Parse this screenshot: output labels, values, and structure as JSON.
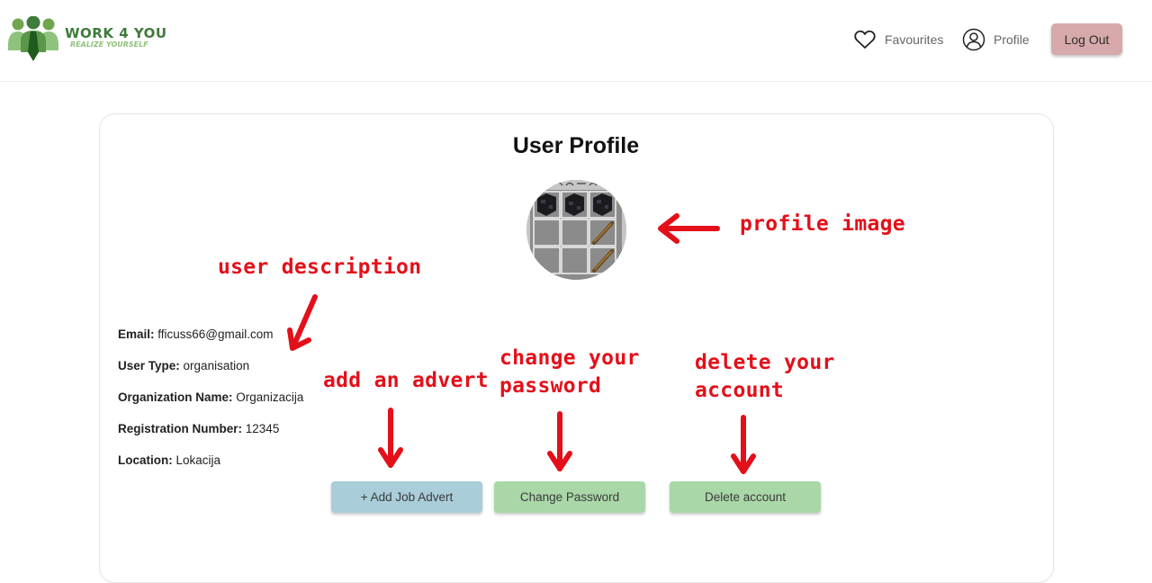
{
  "header": {
    "logo": {
      "title": "WORK 4 YOU",
      "tagline": "REALIZE YOURSELF"
    },
    "nav": {
      "favourites": {
        "label": "Favourites",
        "icon": "heart-icon"
      },
      "profile": {
        "label": "Profile",
        "icon": "user-circle-icon"
      }
    },
    "logout_label": "Log Out"
  },
  "profile": {
    "title": "User Profile",
    "fields": [
      {
        "label": "Email:",
        "value": "fficuss66@gmail.com"
      },
      {
        "label": "User Type:",
        "value": "organisation"
      },
      {
        "label": "Organization Name:",
        "value": "Organizacija"
      },
      {
        "label": "Registration Number:",
        "value": "12345"
      },
      {
        "label": "Location:",
        "value": "Lokacija"
      }
    ]
  },
  "actions": {
    "add_advert": "+ Add Job Advert",
    "change_password": "Change Password",
    "delete_account": "Delete account"
  },
  "annotations": {
    "profile_image": "profile image",
    "user_description": "user description",
    "add_advert": "add an advert",
    "change_password_1": "change your",
    "change_password_2": "password",
    "delete_account_1": "delete your",
    "delete_account_2": "account"
  },
  "colors": {
    "logout": "#d8a9aa",
    "add_advert": "#a9cdd9",
    "change_password": "#aad7a8",
    "delete_account": "#aad7a8",
    "annotation": "#e3101a",
    "brand": "#3f7b3a"
  }
}
